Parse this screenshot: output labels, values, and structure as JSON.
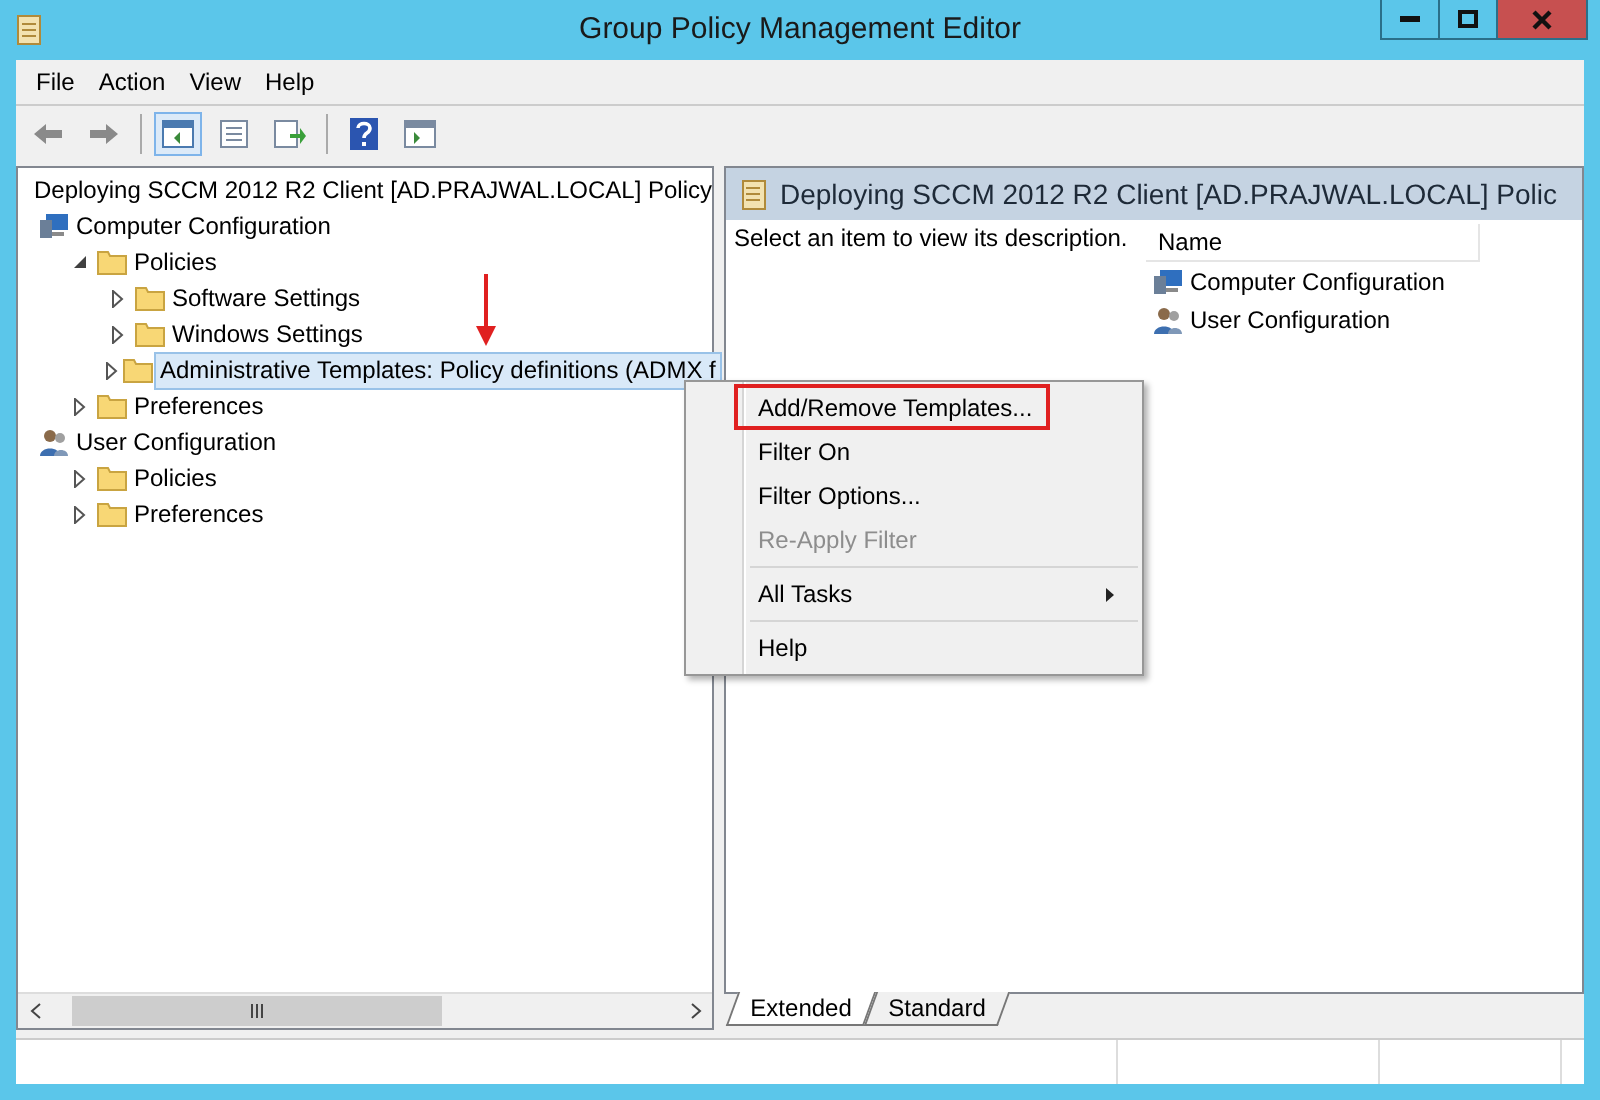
{
  "window": {
    "title": "Group Policy Management Editor"
  },
  "menu_bar": [
    "File",
    "Action",
    "View",
    "Help"
  ],
  "tree": {
    "label": "Deploying SCCM 2012 R2 Client [AD.PRAJWAL.LOCAL] Policy",
    "children": [
      {
        "label": "Computer Configuration",
        "kind": "computer",
        "selected": false,
        "children": [
          {
            "label": "Policies",
            "kind": "folder",
            "expanded": true,
            "selected": false,
            "children": [
              {
                "label": "Software Settings",
                "kind": "folder",
                "expanded": false,
                "selected": false
              },
              {
                "label": "Windows Settings",
                "kind": "folder",
                "expanded": false,
                "selected": false
              },
              {
                "label": "Administrative Templates: Policy definitions (ADMX f",
                "kind": "folder",
                "expanded": false,
                "selected": true
              }
            ]
          },
          {
            "label": "Preferences",
            "kind": "folder",
            "expanded": false,
            "selected": false
          }
        ]
      },
      {
        "label": "User Configuration",
        "kind": "user",
        "selected": false,
        "children": [
          {
            "label": "Policies",
            "kind": "folder",
            "expanded": false,
            "selected": false
          },
          {
            "label": "Preferences",
            "kind": "folder",
            "expanded": false,
            "selected": false
          }
        ]
      }
    ]
  },
  "details": {
    "title": "Deploying SCCM 2012 R2 Client [AD.PRAJWAL.LOCAL] Polic",
    "description": "Select an item to view its description.",
    "columns": [
      "Name"
    ],
    "items": [
      {
        "label": "Computer Configuration",
        "kind": "computer"
      },
      {
        "label": "User Configuration",
        "kind": "user"
      }
    ]
  },
  "tabs": [
    {
      "label": "Extended",
      "selected": true
    },
    {
      "label": "Standard",
      "selected": false
    }
  ],
  "context_menu": [
    {
      "kind": "item",
      "label": "Add/Remove Templates...",
      "disabled": false,
      "submenu": false,
      "highlighted": true
    },
    {
      "kind": "item",
      "label": "Filter On",
      "disabled": false,
      "submenu": false,
      "highlighted": false
    },
    {
      "kind": "item",
      "label": "Filter Options...",
      "disabled": false,
      "submenu": false,
      "highlighted": false
    },
    {
      "kind": "item",
      "label": "Re-Apply Filter",
      "disabled": true,
      "submenu": false,
      "highlighted": false
    },
    {
      "kind": "separator"
    },
    {
      "kind": "item",
      "label": "All Tasks",
      "disabled": false,
      "submenu": true,
      "highlighted": false
    },
    {
      "kind": "separator"
    },
    {
      "kind": "item",
      "label": "Help",
      "disabled": false,
      "submenu": false,
      "highlighted": false
    }
  ]
}
